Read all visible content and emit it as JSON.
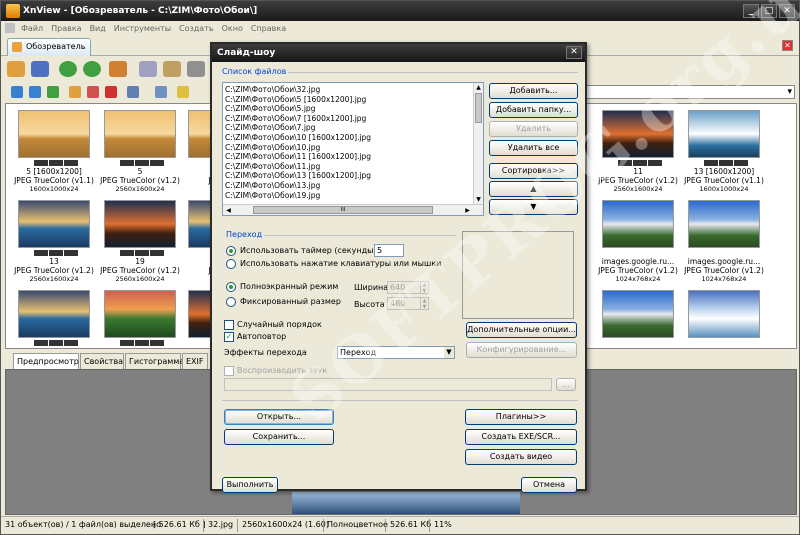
{
  "window": {
    "title": "XnView - [Обозреватель - C:\\ZIM\\Фото\\Обои\\]",
    "controls": [
      "_",
      "□",
      "✕"
    ]
  },
  "menu": [
    "Файл",
    "Правка",
    "Вид",
    "Инструменты",
    "Создать",
    "Окно",
    "Справка"
  ],
  "tab": {
    "label": "Обозреватель",
    "close": "✕"
  },
  "thumbnails": [
    {
      "name": "5 [1600x1200]",
      "format": "JPEG TrueColor (v1.1)",
      "size": "1600x1000x24",
      "img": "pyramid"
    },
    {
      "name": "5",
      "format": "JPEG TrueColor (v1.2)",
      "size": "2560x1600x24",
      "img": "pyramid"
    },
    {
      "name": "7 [16",
      "format": "JPEG Tru",
      "size": "1600",
      "img": "pyramid"
    },
    {
      "name": "13",
      "format": "JPEG TrueColor (v1.2)",
      "size": "2560x1600x24",
      "img": "sea"
    },
    {
      "name": "19",
      "format": "JPEG TrueColor (v1.2)",
      "size": "2560x1600x24",
      "img": "sunset"
    },
    {
      "name": "2",
      "format": "JPEG Tru",
      "size": "2560",
      "img": "sea"
    },
    {
      "name": "",
      "format": "",
      "size": "",
      "img": "sea"
    },
    {
      "name": "",
      "format": "",
      "size": "",
      "img": "field"
    },
    {
      "name": "",
      "format": "",
      "size": "",
      "img": "sunset"
    },
    {
      "name": "11",
      "format": "JPEG TrueColor (v1.2)",
      "size": "2560x1600x24",
      "img": "sunset"
    },
    {
      "name": "13 [1600x1200]",
      "format": "JPEG TrueColor (v1.1)",
      "size": "1600x1000x24",
      "img": "surf"
    },
    {
      "name": "images.google.ru...",
      "format": "JPEG TrueColor (v1.2)",
      "size": "1024x768x24",
      "img": "mount"
    },
    {
      "name": "images.google.ru...",
      "format": "JPEG TrueColor (v1.2)",
      "size": "1024x768x24",
      "img": "mount"
    },
    {
      "name": "",
      "format": "",
      "size": "",
      "img": "mount"
    },
    {
      "name": "",
      "format": "",
      "size": "",
      "img": "ice"
    }
  ],
  "bottom_tabs": [
    "Предпросмотр",
    "Свойства",
    "Гистограмма",
    "EXIF"
  ],
  "status": {
    "objects": "31 объект(ов) / 1 файл(ов) выделено",
    "selsize": "[ 526.61 Кб ]",
    "file": "32.jpg",
    "dims": "2560x1600x24 (1.60)",
    "color": "Полноцветное",
    "size": "526.61 Кб",
    "zoom": "11%"
  },
  "dialog": {
    "title": "Слайд-шоу",
    "close": "✕",
    "files_group": "Список файлов",
    "files": [
      "C:\\ZIM\\Фото\\Обои\\32.jpg",
      "C:\\ZIM\\Фото\\Обои\\5 [1600x1200].jpg",
      "C:\\ZIM\\Фото\\Обои\\5.jpg",
      "C:\\ZIM\\Фото\\Обои\\7 [1600x1200].jpg",
      "C:\\ZIM\\Фото\\Обои\\7.jpg",
      "C:\\ZIM\\Фото\\Обои\\10 [1600x1200].jpg",
      "C:\\ZIM\\Фото\\Обои\\10.jpg",
      "C:\\ZIM\\Фото\\Обои\\11 [1600x1200].jpg",
      "C:\\ZIM\\Фото\\Обои\\11.jpg",
      "C:\\ZIM\\Фото\\Обои\\13 [1600x1200].jpg",
      "C:\\ZIM\\Фото\\Обои\\13.jpg",
      "C:\\ZIM\\Фото\\Обои\\19.jpg"
    ],
    "add": "Добавить...",
    "add_folder": "Добавить папку...",
    "remove": "Удалить",
    "remove_all": "Удалить все",
    "sort": "Сортировка>>",
    "up": "▲",
    "down": "▼",
    "scroll_thumb": "III",
    "transition_group": "Переход",
    "use_timer": "Использовать таймер (секунды)",
    "timer_value": "5",
    "use_keyboard": "Использовать нажатие клавиатуры или мышки",
    "fullscreen": "Полноэкранный режим",
    "fixed": "Фиксированный размер",
    "width_label": "Ширина",
    "width_value": "640",
    "height_label": "Высота",
    "height_value": "480",
    "random": "Случайный порядок",
    "autorepeat": "Автоповтор",
    "effects_label": "Эффекты перехода",
    "effect_value": "Переход",
    "more_options": "Дополнительные опции...",
    "configure": "Конфигурирование...",
    "play_sound": "Воспроизводить звук",
    "browse": "...",
    "open": "Открыть...",
    "save": "Сохранить...",
    "plugins": "Плагины>>",
    "create_exe": "Создать EXE/SCR...",
    "create_video": "Создать видео",
    "run": "Выполнить",
    "cancel": "Отмена"
  },
  "watermark": "SOFTPROG.org.ua"
}
